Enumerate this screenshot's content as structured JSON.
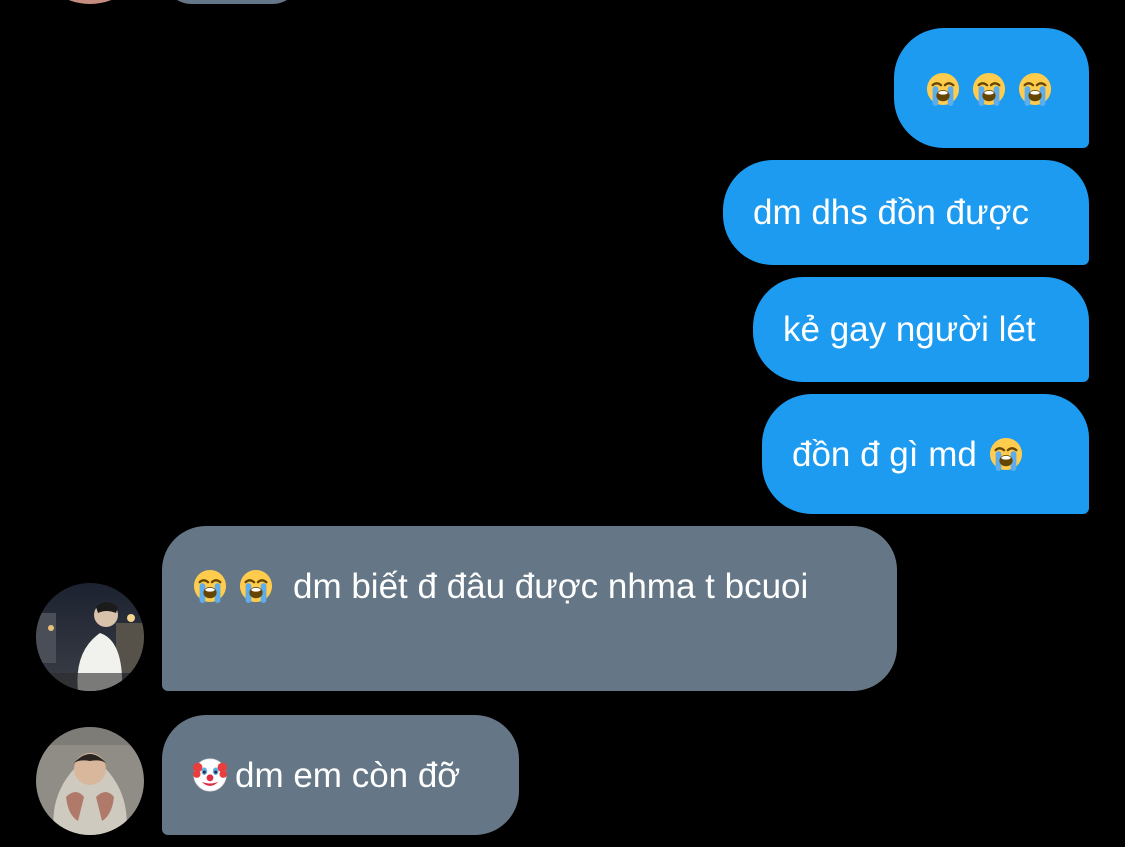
{
  "chat": {
    "messages": [
      {
        "id": "m1",
        "direction": "outgoing",
        "emojis": [
          "loudly-crying-face",
          "loudly-crying-face",
          "loudly-crying-face"
        ],
        "text": ""
      },
      {
        "id": "m2",
        "direction": "outgoing",
        "text": "dm dhs đồn được"
      },
      {
        "id": "m3",
        "direction": "outgoing",
        "text": "kẻ gay người lét"
      },
      {
        "id": "m4",
        "direction": "outgoing",
        "text": "đồn đ gì md",
        "trailing_emoji": "loudly-crying-face"
      },
      {
        "id": "m5",
        "direction": "incoming",
        "leading_emojis": [
          "loudly-crying-face",
          "loudly-crying-face"
        ],
        "text": "dm biết đ đâu được nhma t bcuoi"
      },
      {
        "id": "m6",
        "direction": "incoming",
        "leading_emoji": "clown-face",
        "text": "dm em còn đỡ"
      }
    ]
  },
  "colors": {
    "background": "#000000",
    "outgoing_bubble": "#1d9bf0",
    "incoming_bubble": "#657786",
    "text": "#ffffff"
  }
}
